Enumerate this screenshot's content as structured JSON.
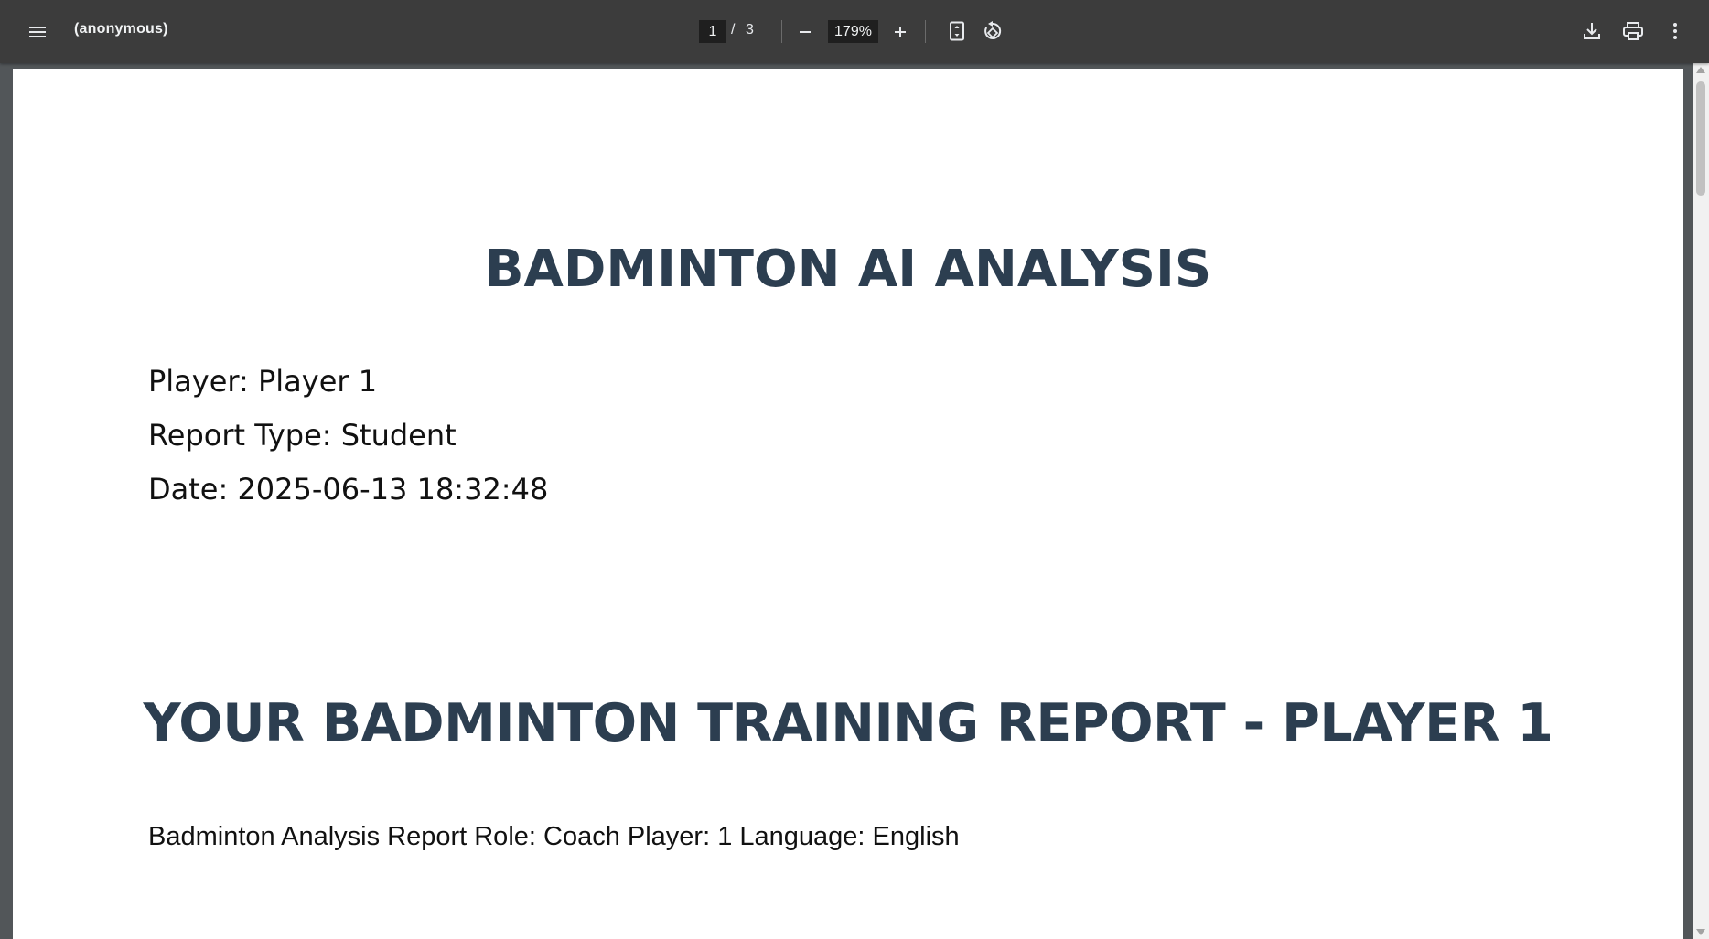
{
  "toolbar": {
    "menu_icon": "hamburger-menu-icon",
    "title": "(anonymous)",
    "page_current": "1",
    "page_separator": "/",
    "page_total": "3",
    "zoom_out_icon": "minus-icon",
    "zoom_value": "179%",
    "zoom_in_icon": "plus-icon",
    "fit_icon": "fit-to-page-icon",
    "rotate_icon": "rotate-counterclockwise-icon",
    "download_icon": "download-icon",
    "print_icon": "print-icon",
    "more_icon": "more-vertical-icon",
    "background_color": "#3c3c3c"
  },
  "document": {
    "heading": "BADMINTON AI ANALYSIS",
    "player_line": "Player: Player 1",
    "report_type_line": "Report Type: Student",
    "date_line": "Date: 2025-06-13 18:32:48",
    "section_heading": "YOUR BADMINTON TRAINING REPORT - PLAYER 1",
    "summary_line": "Badminton Analysis Report Role: Coach Player: 1 Language: English",
    "heading_color": "#2c3e50"
  },
  "viewer": {
    "background_color": "#525659"
  }
}
